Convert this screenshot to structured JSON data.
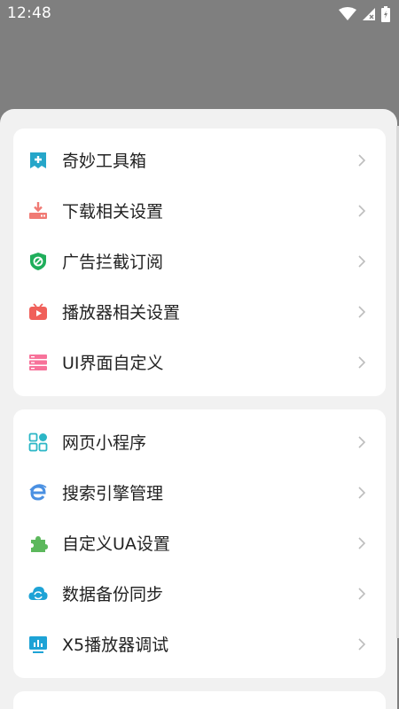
{
  "status_bar": {
    "time": "12:48"
  },
  "colors": {
    "backdrop": "#7f7f7f",
    "sheet": "#f1f1f1",
    "card": "#ffffff",
    "text": "#222222",
    "chevron": "#bdbdbd"
  },
  "menu": {
    "group1": [
      {
        "label": "奇妙工具箱",
        "icon": "toolbox-icon",
        "color": "#26a6c9"
      },
      {
        "label": "下载相关设置",
        "icon": "download-icon",
        "color": "#f07a74"
      },
      {
        "label": "广告拦截订阅",
        "icon": "ad-block-shield-icon",
        "color": "#1fae5b"
      },
      {
        "label": "播放器相关设置",
        "icon": "tv-player-icon",
        "color": "#f0605a"
      },
      {
        "label": "UI界面自定义",
        "icon": "ui-layout-icon",
        "color": "#f7729a"
      }
    ],
    "group2": [
      {
        "label": "网页小程序",
        "icon": "mini-program-grid-icon",
        "color": "#2bb6c6"
      },
      {
        "label": "搜索引擎管理",
        "icon": "search-engine-e-icon",
        "color": "#4a90e2"
      },
      {
        "label": "自定义UA设置",
        "icon": "puzzle-icon",
        "color": "#5cb85c"
      },
      {
        "label": "数据备份同步",
        "icon": "cloud-sync-icon",
        "color": "#1ea3d6"
      },
      {
        "label": "X5播放器调试",
        "icon": "monitor-chart-icon",
        "color": "#1ea3d6"
      }
    ]
  }
}
